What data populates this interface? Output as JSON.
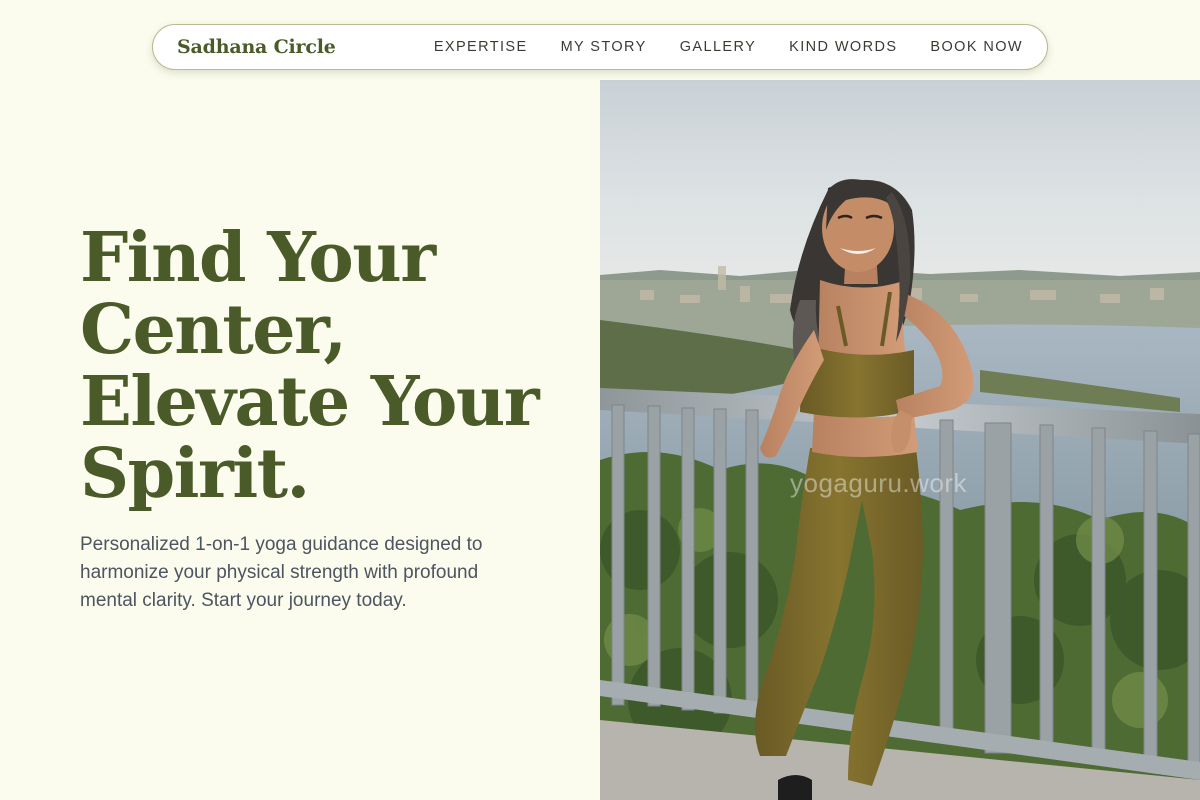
{
  "brand": {
    "name": "Sadhana Circle"
  },
  "nav": {
    "items": [
      {
        "label": "EXPERTISE"
      },
      {
        "label": "MY STORY"
      },
      {
        "label": "GALLERY"
      },
      {
        "label": "KIND WORDS"
      },
      {
        "label": "BOOK NOW"
      }
    ]
  },
  "hero": {
    "title_lines": [
      "Find Your",
      "Center,",
      "Elevate Your",
      "Spirit."
    ],
    "subtitle": "Personalized 1-on-1 yoga guidance designed to harmonize your physical strength with profound mental clarity. Start your journey today.",
    "image_watermark": "yogaguru.work"
  },
  "colors": {
    "background": "#fbfcee",
    "accent_olive": "#4a5a28",
    "nav_text": "#3b3b36",
    "body_text": "#4c5560"
  }
}
